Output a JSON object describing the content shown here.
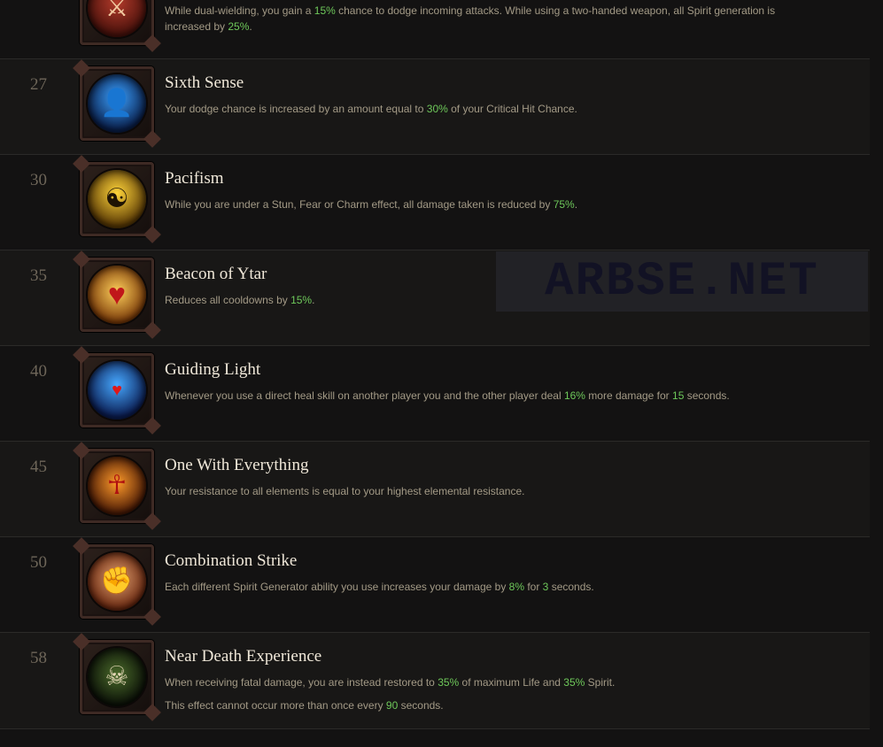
{
  "passives": [
    {
      "level": "",
      "name": "",
      "icon": "dual-wield-warrior-icon",
      "desc_parts": [
        "While dual-wielding, you gain a ",
        "15%",
        " chance to dodge incoming attacks. While using a two-handed weapon, all Spirit generation is",
        "",
        ""
      ],
      "desc_line2_parts": [
        "increased by ",
        "25%",
        "."
      ]
    },
    {
      "level": "27",
      "name": "Sixth Sense",
      "icon": "sixth-sense-icon",
      "desc_parts": [
        "Your dodge chance is increased by an amount equal to ",
        "30%",
        " of your Critical Hit Chance.",
        "",
        ""
      ]
    },
    {
      "level": "30",
      "name": "Pacifism",
      "icon": "pacifism-icon",
      "desc_parts": [
        "While you are under a Stun, Fear or Charm effect, all damage taken is reduced by ",
        "75%",
        ".",
        "",
        ""
      ]
    },
    {
      "level": "35",
      "name": "Beacon of Ytar",
      "icon": "beacon-of-ytar-heart-icon",
      "desc_parts": [
        "Reduces all cooldowns by ",
        "15%",
        ".",
        "",
        ""
      ]
    },
    {
      "level": "40",
      "name": "Guiding Light",
      "icon": "guiding-light-icon",
      "desc_parts": [
        "Whenever you use a direct heal skill on another player you and the other player deal ",
        "16%",
        " more damage for ",
        "15",
        " seconds."
      ]
    },
    {
      "level": "45",
      "name": "One With Everything",
      "icon": "one-with-everything-icon",
      "desc_parts": [
        "Your resistance to all elements is equal to your highest elemental resistance.",
        "",
        "",
        "",
        ""
      ]
    },
    {
      "level": "50",
      "name": "Combination Strike",
      "icon": "combination-strike-fist-icon",
      "desc_parts": [
        "Each different Spirit Generator ability you use increases your damage by ",
        "8%",
        " for ",
        "3",
        " seconds."
      ]
    },
    {
      "level": "58",
      "name": "Near Death Experience",
      "icon": "near-death-skull-icon",
      "desc_parts": [
        "When receiving fatal damage, you are instead restored to ",
        "35%",
        " of maximum Life and ",
        "35%",
        " Spirit."
      ],
      "desc_extra_parts": [
        "This effect cannot occur more than once every ",
        "90",
        " seconds."
      ]
    }
  ],
  "watermark": "ARBSE.NET",
  "colors": {
    "highlight": "#6ec85a",
    "title": "#efe7d8",
    "desc": "#a39a86",
    "level": "#6e6659"
  }
}
